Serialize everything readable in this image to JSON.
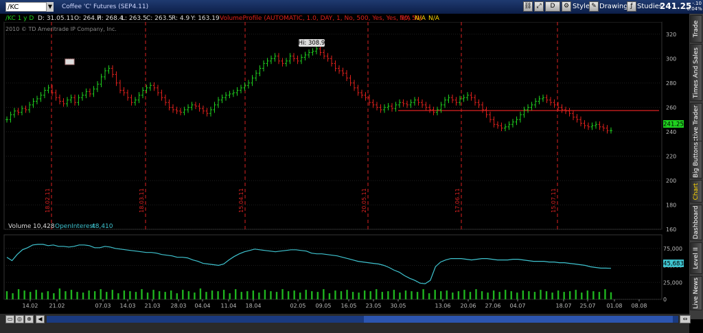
{
  "header": {
    "symbol": "/KC",
    "description": "Coffee 'C' Futures (SEP4.11)",
    "buttons": [
      "D"
    ],
    "style_label": "Style",
    "drawings_label": "Drawings",
    "studies_label": "Studies",
    "last_price": "241.25",
    "change": "-.10",
    "change_pct": "-0.04%"
  },
  "sidebar_tabs": [
    "Trade",
    "Times And Sales",
    "Active Trader",
    "Big Buttons",
    "Chart",
    "Dashboard",
    "Level II",
    "Live News"
  ],
  "active_tab": "Chart",
  "price_panel": {
    "label": "/KC 1 y D",
    "ohlc": [
      {
        "label": "D: 31.05.11"
      },
      {
        "label": "O: 264.7"
      },
      {
        "label": "H: 268.4"
      },
      {
        "label": "L: 263.5"
      },
      {
        "label": "C: 263.5"
      },
      {
        "label": "R: 4.9"
      },
      {
        "label": "Y: 163.19"
      }
    ],
    "study": "VolumeProfile (AUTOMATIC, 1.0, DAY, 1, No, 500, Yes, Yes, 70, 50)",
    "na1": "N/A",
    "na2": "N/A",
    "na3": "N/A",
    "copyright": "2010 © TD Ameritrade IP Company, Inc.",
    "hi_label": "Hi: 308.9",
    "current_price": "241.25",
    "y_ticks": [
      "320",
      "300",
      "280",
      "260",
      "240",
      "220",
      "200",
      "180",
      "160"
    ],
    "marker_dates": [
      "18.02.11",
      "18.03.11",
      "15.04.11",
      "20.05.11",
      "17.06.11",
      "15.07.11"
    ]
  },
  "volume_panel": {
    "volume_label": "Volume",
    "volume_value": "10,428",
    "oi_label": "OpenInterest",
    "oi_value": "48,410",
    "current_oi": "45,683",
    "y_ticks": [
      "75,000",
      "50,000",
      "25,000",
      "0"
    ]
  },
  "x_ticks": [
    "14.02",
    "21.02",
    "07.03",
    "14.03",
    "21.03",
    "28.03",
    "04.04",
    "11.04",
    "18.04",
    "02.05",
    "09.05",
    "16.05",
    "23.05",
    "30.05",
    "13.06",
    "20.06",
    "27.06",
    "04.07",
    "18.07",
    "25.07",
    "01.08",
    "08.08"
  ],
  "colors": {
    "up": "#1fd11f",
    "down": "#e0201c",
    "oi": "#3fc4d0",
    "marker": "#d22",
    "support": "#d22",
    "volume": "#1fb41f"
  },
  "chart_data": {
    "type": "candlestick",
    "price_ylim": [
      160,
      330
    ],
    "closes": [
      250,
      254,
      257,
      256,
      259,
      258,
      262,
      265,
      267,
      270,
      274,
      276,
      272,
      268,
      265,
      263,
      266,
      268,
      264,
      268,
      270,
      273,
      271,
      275,
      279,
      285,
      290,
      292,
      287,
      280,
      274,
      272,
      268,
      264,
      266,
      270,
      274,
      276,
      278,
      276,
      272,
      268,
      264,
      260,
      258,
      257,
      256,
      258,
      260,
      262,
      261,
      259,
      257,
      255,
      258,
      262,
      266,
      268,
      270,
      271,
      272,
      274,
      276,
      278,
      280,
      284,
      288,
      292,
      296,
      298,
      300,
      302,
      298,
      296,
      298,
      302,
      300,
      298,
      301,
      303,
      305,
      306,
      308,
      305,
      302,
      300,
      296,
      292,
      290,
      288,
      284,
      280,
      276,
      272,
      270,
      268,
      264,
      262,
      260,
      258,
      260,
      261,
      259,
      262,
      264,
      263,
      262,
      264,
      266,
      264,
      262,
      260,
      258,
      256,
      258,
      262,
      266,
      268,
      266,
      264,
      267,
      268,
      270,
      268,
      264,
      262,
      258,
      254,
      250,
      246,
      245,
      243,
      244,
      246,
      248,
      250,
      254,
      258,
      260,
      262,
      265,
      267,
      268,
      266,
      264,
      262,
      260,
      258,
      257,
      255,
      252,
      250,
      247,
      245,
      244,
      245,
      246,
      244,
      243,
      241,
      241
    ],
    "oi_ylim": [
      0,
      95000
    ],
    "open_interest": [
      62000,
      57000,
      66000,
      73000,
      76000,
      80000,
      81000,
      81000,
      79000,
      80000,
      78000,
      78000,
      77000,
      78000,
      80000,
      80000,
      79000,
      76000,
      76000,
      78000,
      77000,
      75000,
      74000,
      73000,
      72000,
      71000,
      70000,
      69000,
      69000,
      68000,
      66000,
      65000,
      64000,
      62000,
      62000,
      61000,
      58000,
      56000,
      53000,
      52000,
      51000,
      50000,
      52000,
      58000,
      63000,
      67000,
      70000,
      72000,
      74000,
      73000,
      72000,
      71000,
      70000,
      71000,
      72000,
      73000,
      73000,
      72000,
      71000,
      68000,
      67000,
      67000,
      66000,
      65000,
      64000,
      62000,
      60000,
      58000,
      56000,
      55000,
      54000,
      53000,
      52000,
      50000,
      47000,
      43000,
      40000,
      35000,
      31000,
      28000,
      24000,
      23000,
      28000,
      48000,
      55000,
      58000,
      60000,
      60000,
      60000,
      59000,
      58000,
      59000,
      60000,
      60000,
      59000,
      58000,
      58000,
      58000,
      59000,
      59000,
      58000,
      57000,
      56000,
      56000,
      56000,
      55000,
      55000,
      54000,
      54000,
      53000,
      52000,
      51000,
      50000,
      48000,
      47000,
      46000,
      46000,
      45683
    ],
    "volume_ylim": [
      0,
      95000
    ],
    "volume": [
      12000,
      9000,
      15000,
      13000,
      11000,
      14000,
      10000,
      12000,
      9000,
      16000,
      12000,
      14000,
      11000,
      10000,
      13000,
      12000,
      15000,
      11000,
      14000,
      9000,
      13000,
      12000,
      11000,
      15000,
      10000,
      14000,
      12000,
      11000,
      13000,
      9000,
      14000,
      12000,
      10000,
      16000,
      11000,
      13000,
      12000,
      14000,
      9000,
      15000,
      11000,
      12000,
      13000,
      10000,
      14000,
      12000,
      11000,
      15000,
      12000,
      13000,
      10000,
      14000,
      12000,
      11000,
      15000,
      9000,
      13000,
      12000,
      14000,
      11000,
      10000,
      13000,
      12000,
      15000,
      11000,
      12000,
      14000,
      10000,
      13000,
      12000,
      11000,
      15000,
      9000,
      14000,
      12000,
      13000,
      10000,
      12000,
      14000,
      11000,
      15000,
      12000,
      10000,
      13000,
      11000,
      14000,
      12000,
      10000,
      13000,
      12000,
      11000,
      14000,
      12000,
      10000,
      13000,
      11000,
      12000,
      14000,
      10000,
      13000,
      12000,
      11000,
      15000,
      10428
    ]
  }
}
